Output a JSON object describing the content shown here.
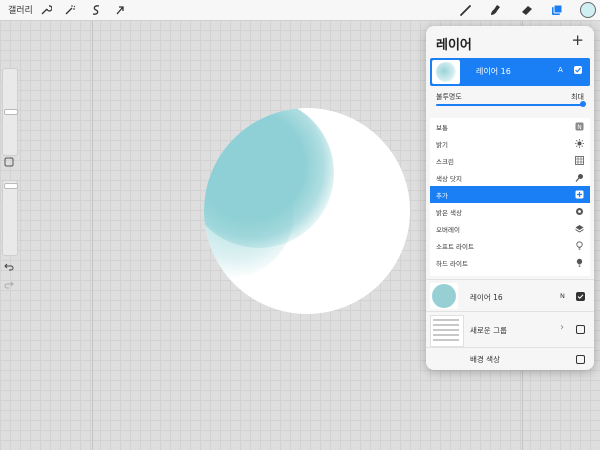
{
  "topbar": {
    "gallery_label": "갤러리",
    "left_tools": [
      "wrench-icon",
      "magic-wand-icon",
      "selection-s-icon",
      "move-arrow-icon"
    ],
    "right_tools": [
      "brush-icon",
      "smudge-icon",
      "eraser-icon",
      "layers-icon"
    ],
    "current_color": "#cfeff2"
  },
  "layers_panel": {
    "title": "레이어",
    "add_label": "+",
    "active_layer": {
      "name": "레이어 16",
      "mode": "A",
      "visible": true
    },
    "opacity_label": "불투명도",
    "opacity_max_label": "최대",
    "opacity_value": 1.0,
    "blend_modes": [
      {
        "label": "보통",
        "icon": "n-icon"
      },
      {
        "label": "밝기",
        "icon": "sun-icon"
      },
      {
        "label": "스크린",
        "icon": "screen-icon"
      },
      {
        "label": "색상 닷지",
        "icon": "dodge-icon"
      },
      {
        "label": "추가",
        "icon": "add-icon",
        "selected": true
      },
      {
        "label": "밝은 색상",
        "icon": "lighter-color-icon"
      },
      {
        "label": "오버레이",
        "icon": "overlay-icon"
      },
      {
        "label": "소프트 라이트",
        "icon": "bulb-icon"
      },
      {
        "label": "하드 라이트",
        "icon": "hard-light-icon"
      }
    ],
    "layers": [
      {
        "name": "레이어 16",
        "mode": "N",
        "checked": true
      },
      {
        "name": "새로운 그룹",
        "mode": "",
        "checked": false
      },
      {
        "name": "배경 색상",
        "mode": "",
        "checked": false
      }
    ]
  },
  "colors": {
    "accent": "#1a7ff5",
    "paint": "#8ed0d5"
  }
}
